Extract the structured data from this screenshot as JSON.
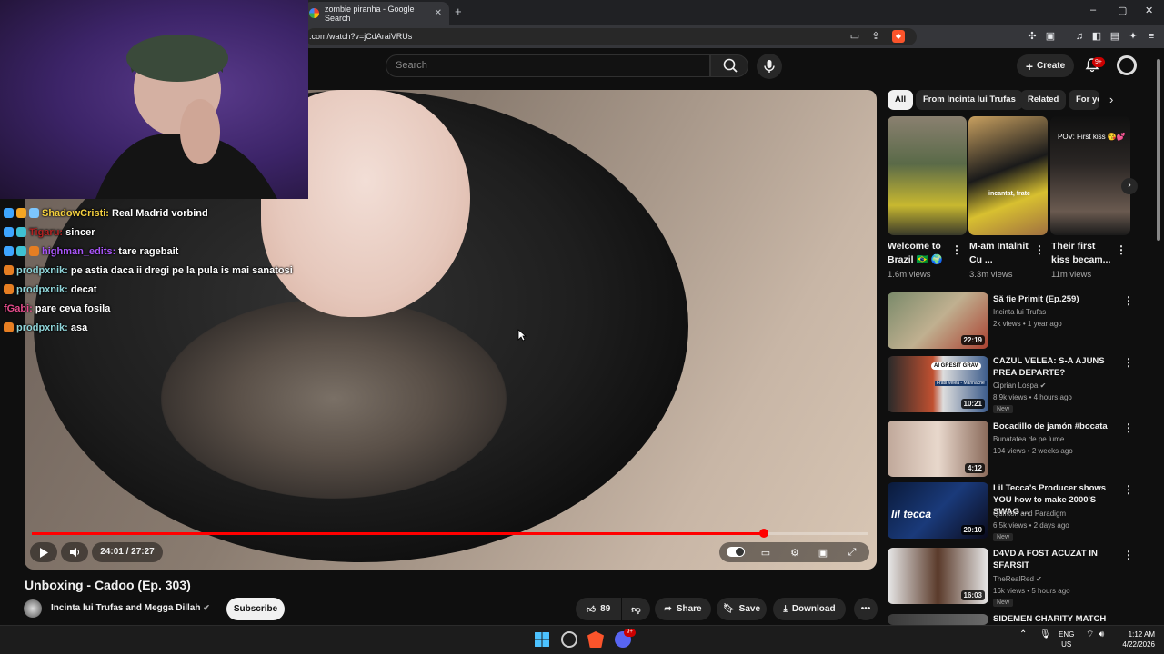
{
  "browser": {
    "tab_title": "zombie piranha - Google Search",
    "new_tab": "+",
    "url": ".com/watch?v=jCdAraiVRUs",
    "window_controls": [
      "–",
      "▢",
      "✕"
    ]
  },
  "header": {
    "search_placeholder": "Search",
    "create_label": "Create",
    "notif_badge": "9+"
  },
  "player": {
    "time": "24:01 / 27:27",
    "progress": 0.875
  },
  "overlay_chat": [
    {
      "user": "ShadowCristi:",
      "msg": "Real Madrid vorbind",
      "color": "#f4d03f",
      "badges": [
        "#3ea6ff",
        "#f5a623",
        "#7cc6fe"
      ]
    },
    {
      "user": "Tigaru:",
      "msg": "sincer",
      "color": "#b22222",
      "badges": [
        "#3ea6ff",
        "#3ec1d3"
      ]
    },
    {
      "user": "highman_edits:",
      "msg": "tare ragebait",
      "color": "#a855f7",
      "badges": [
        "#3ea6ff",
        "#3ec1d3",
        "#e67e22"
      ]
    },
    {
      "user": "prodpxnik:",
      "msg": "pe astia daca ii dregi pe la pula is mai sanatosi",
      "color": "#8fd5d9",
      "badges": [
        "#e67e22"
      ]
    },
    {
      "user": "prodpxnik:",
      "msg": "decat",
      "color": "#8fd5d9",
      "badges": [
        "#e67e22"
      ]
    },
    {
      "user": "fGabi:",
      "msg": "pare ceva fosila",
      "color": "#e74c8c",
      "badges": []
    },
    {
      "user": "prodpxnik:",
      "msg": "asa",
      "color": "#8fd5d9",
      "badges": [
        "#e67e22"
      ]
    }
  ],
  "video": {
    "title": "Unboxing - Cadoo (Ep. 303)",
    "channel": "Incinta lui Trufas and Megga Dillah",
    "subscribe": "Subscribe",
    "likes": "89",
    "share": "Share",
    "save": "Save",
    "download": "Download"
  },
  "chips": [
    "All",
    "From Incinta lui Trufas",
    "Related",
    "For yo"
  ],
  "shorts": [
    {
      "title": "Welcome to Brazil 🇧🇷 🌍",
      "views": "1.6m views",
      "overlay": ""
    },
    {
      "title": "M-am Intalnit Cu ...",
      "views": "3.3m views",
      "overlay": "incantat, frate"
    },
    {
      "title": "Their first kiss becam...",
      "views": "11m views",
      "overlay": "POV: First kiss 😘💕"
    }
  ],
  "recommended": [
    {
      "title": "Să fie Primit (Ep.259)",
      "channel": "Incinta lui Trufas",
      "meta": "2k views • 1 year ago",
      "duration": "22:19",
      "new": "",
      "verified": false
    },
    {
      "title": "CAZUL VELEA: S-A AJUNS PREA DEPARTE?",
      "channel": "Ciprian Lospa",
      "meta": "8.9k views • 4 hours ago",
      "duration": "10:21",
      "new": "New",
      "verified": true,
      "thumb_text": "AI GRESIT GRAV",
      "thumb_sub": "Fratii Velea - Marinache"
    },
    {
      "title": "Bocadillo de jamón #bocata",
      "channel": "Bunatatea de pe lume",
      "meta": "104 views • 2 weeks ago",
      "duration": "4:12",
      "new": "",
      "verified": false
    },
    {
      "title": "Lil Tecca's Producer shows YOU how to make 2000'S SWAG ...",
      "channel": "Quinton and Paradigm",
      "meta": "6.5k views • 2 days ago",
      "duration": "20:10",
      "new": "New",
      "verified": false,
      "thumb_text": "lil tecca"
    },
    {
      "title": "D4VD A FOST ACUZAT IN SFARSIT",
      "channel": "TheRealRed",
      "meta": "16k views • 5 hours ago",
      "duration": "16:03",
      "new": "New",
      "verified": true
    },
    {
      "title": "SIDEMEN CHARITY MATCH",
      "channel": "",
      "meta": "",
      "duration": "",
      "new": "",
      "verified": false
    }
  ],
  "taskbar": {
    "lang": "ENG",
    "region": "US",
    "time": "1:12 AM",
    "date": "4/22/2026",
    "discord_badge": "9+"
  }
}
